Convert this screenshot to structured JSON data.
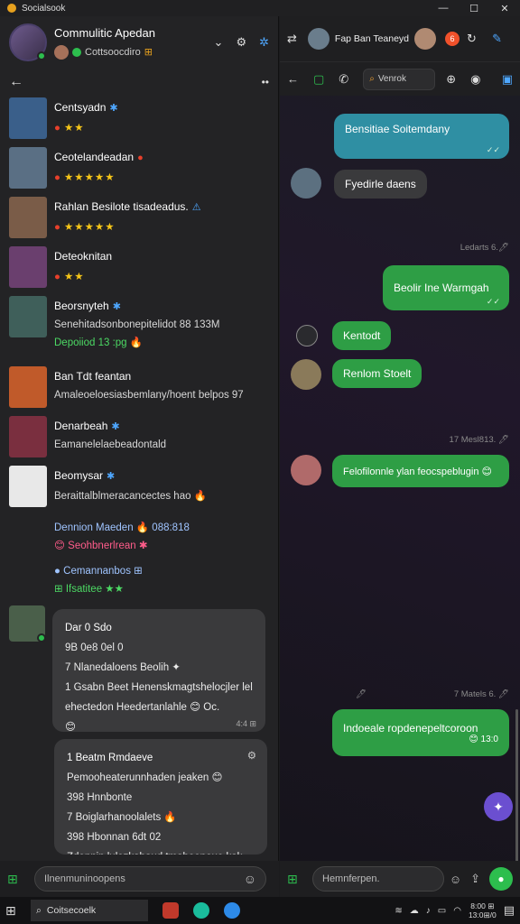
{
  "window": {
    "title": "Socialsook",
    "controls": [
      "—",
      "☐",
      "✕"
    ]
  },
  "profile": {
    "name": "Commulitic Apedan",
    "status": "Cottsoocdiro",
    "status_icon": "⊞"
  },
  "contacts": [
    {
      "name": "Centsyadn",
      "badge": "✱",
      "line": "★★",
      "line_prefix": "●",
      "stars": true,
      "avatar_color": "#3a5f8a"
    },
    {
      "name": "Ceotelandeadan",
      "badge": "●",
      "line": "★★★★★",
      "line_prefix": "●",
      "stars": true,
      "avatar_color": "#5a6f84"
    },
    {
      "name": "Rahlan Besilote tisadeadus.",
      "badge": "⚠",
      "line": "★★★★★",
      "line_prefix": "●",
      "stars": true,
      "avatar_color": "#7a5c48"
    },
    {
      "name": "Deteoknitan",
      "badge": "",
      "line": "★★",
      "line_prefix": "●",
      "stars": true,
      "avatar_color": "#6a3f6e"
    },
    {
      "name": "Beorsnyteh",
      "badge": "✱",
      "line": "Senehitadsonbonepitelidot 88 133M",
      "line_prefix": "",
      "stars": false,
      "avatar_color": "#3f5f5a"
    },
    {
      "name": "",
      "badge": "",
      "line": "Depoiiod 13 :pg 🔥",
      "line_prefix": "●",
      "stars": false,
      "green": true,
      "avatar_color": "#3f5f5a"
    },
    {
      "name": "Ban Tdt feantan",
      "badge": "",
      "line": "Amaleoeloesiasbemlany/hoent belpos 97",
      "line_prefix": "",
      "stars": false,
      "avatar_color": "#c05a2a"
    },
    {
      "name": "Denarbeah",
      "badge": "✱",
      "line": "Eamanelelaebeadontald",
      "line_prefix": "",
      "stars": false,
      "avatar_color": "#7a2f3f"
    },
    {
      "name": "Beomysar",
      "badge": "✱",
      "line": "Beraittalblmeracancectes hao 🔥",
      "line_prefix": "",
      "stars": false,
      "avatar_color": "#e8e8e8"
    }
  ],
  "extra_rows": [
    {
      "text": "Dennion Maeden 🔥 088:818",
      "style": "blue"
    },
    {
      "text": "😊 Seohbnerlrean ✱",
      "style": "pink"
    },
    {
      "text": "● Cemannanbos ⊞",
      "style": "blue"
    },
    {
      "text": "⊞ Ifsatitee ★★",
      "style": "green"
    }
  ],
  "thread_card": {
    "title": "Dar 0 Sdo",
    "lines": [
      "9B 0e8 0el 0",
      "7 Nlanedaloens Beolih ✦",
      "1 Gsabn Beet Henenskmagtshelocjler lels",
      "ehectedon Heedertanlahle 😊 Oc.",
      "😊"
    ],
    "time": "4:4 ⊞"
  },
  "thread_card2": {
    "title": "1 Beatm Rmdaeve",
    "lines": [
      "Pemooheaterunnhaden jeaken 😊",
      "398 Hnnbonte",
      "7 Boiglarhanoolalets 🔥",
      "398 Hbonnan 6dt 02",
      "Zdennin lulezkahaud tmahoenoue kak"
    ]
  },
  "composer_left": {
    "placeholder": "Ilnenmuninoopens"
  },
  "chat_header": {
    "contact_name": "Fap Ban Teaneyd",
    "badge": "6"
  },
  "chat_search": {
    "placeholder": "Venrok"
  },
  "messages": [
    {
      "text": "Bensitiae Soitemdany",
      "kind": "out-teal",
      "ticks": "✓✓"
    },
    {
      "text": "Fyedirle daens",
      "kind": "in"
    },
    {
      "text": "Ledarts 6.🖊",
      "kind": "date"
    },
    {
      "text": "Beolir Ine Warmgah",
      "kind": "out",
      "ticks": "✓✓"
    },
    {
      "text": "Kentodt",
      "kind": "out"
    },
    {
      "text": "Renlom Stoelt",
      "kind": "out"
    },
    {
      "text": "17 Mesl813. 🖊",
      "kind": "date"
    },
    {
      "text": "Felofilonnle ylan feocspeblugin 😊",
      "kind": "out",
      "ticks": "✓✓"
    },
    {
      "text": "7 Matels 6. 🖊",
      "kind": "date"
    },
    {
      "text": "Indoeale ropdenepeltcoroon",
      "kind": "out",
      "sub": "😊 13:0"
    }
  ],
  "composer_right": {
    "placeholder": "Hemnferpen."
  },
  "taskbar": {
    "search": "Coitsecoelk",
    "clock_time": "8:00 ⊞",
    "clock_date": "13:0⊞/0"
  },
  "colors": {
    "accent_green": "#2dbe4e",
    "accent_blue": "#4ea7ff",
    "teal_bubble": "#2f8fa3",
    "green_bubble": "#2e9e45"
  }
}
